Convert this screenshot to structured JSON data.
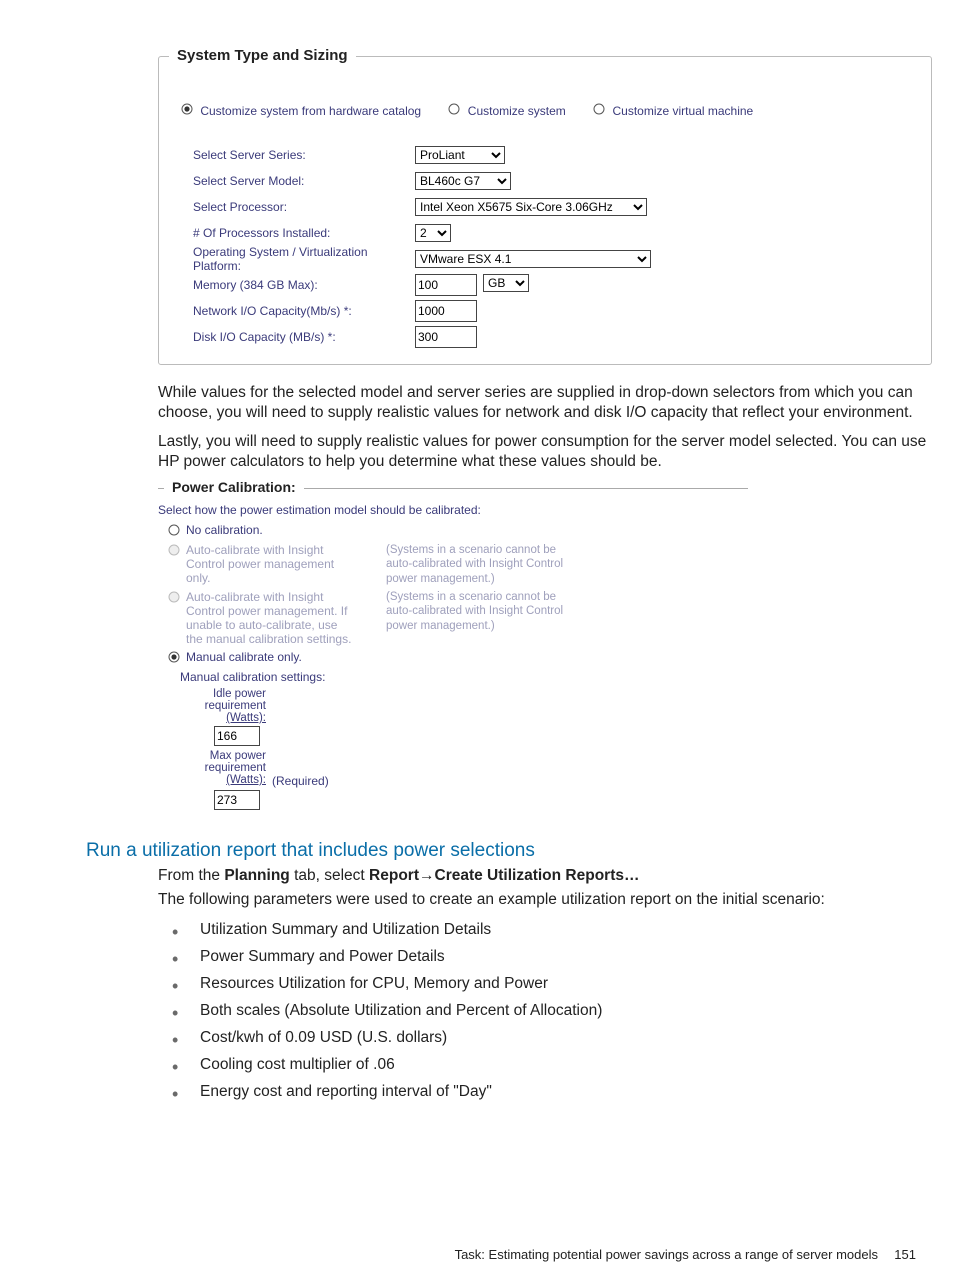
{
  "systemTypeSizing": {
    "legend": "System Type and Sizing",
    "radios": {
      "r1": "Customize system from hardware catalog",
      "r2": "Customize system",
      "r3": "Customize virtual machine"
    },
    "labels": {
      "series": "Select Server Series:",
      "model": "Select Server Model:",
      "processor": "Select Processor:",
      "numproc": "# Of Processors Installed:",
      "os": "Operating System / Virtualization Platform:",
      "memory": "Memory (384 GB Max):",
      "netio": "Network I/O Capacity(Mb/s) *:",
      "diskio": "Disk I/O Capacity (MB/s) *:"
    },
    "values": {
      "series": "ProLiant",
      "model": "BL460c G7",
      "processor": "Intel Xeon X5675 Six-Core 3.06GHz",
      "numproc": "2",
      "os": "VMware ESX 4.1",
      "memory_qty": "100",
      "memory_unit": "GB",
      "netio": "1000",
      "diskio": "300"
    }
  },
  "paras": {
    "p1": "While values for the selected model and server series are supplied in drop-down selectors from which you can choose, you will need to supply realistic values for network and disk I/O capacity that reflect your environment.",
    "p2": "Lastly, you will need to supply realistic values for power consumption for the server model selected. You can use HP power calculators to help you determine what these values should be."
  },
  "powerCal": {
    "legend": "Power Calibration:",
    "prompt": "Select how the power estimation model should be calibrated:",
    "opts": {
      "no": "No calibration.",
      "auto1": "Auto-calibrate with Insight Control power management only.",
      "auto2": "Auto-calibrate with Insight Control power management. If unable to auto-calibrate, use the manual calibration settings.",
      "manual": "Manual calibrate only."
    },
    "hint": "(Systems in a scenario cannot be auto-calibrated with Insight Control power management.)",
    "manualSettings": {
      "title": "Manual calibration settings:",
      "idle_l1": "Idle power",
      "idle_l2": "requirement",
      "watts": "(Watts):",
      "max_l1": "Max power",
      "max_l2": "requirement",
      "idle_val": "166",
      "max_val": "273",
      "required": "(Required)"
    }
  },
  "sectionHeading": "Run a utilization report that includes power selections",
  "instr": {
    "pre": "From the ",
    "b1": "Planning",
    "mid1": " tab, select ",
    "b2": "Report",
    "arrow": "→",
    "b3": "Create Utilization Reports…",
    "p2": "The following parameters were used to create an example utilization report on the initial scenario:"
  },
  "params": [
    "Utilization Summary and Utilization Details",
    "Power Summary and Power Details",
    "Resources Utilization for CPU, Memory and Power",
    "Both scales (Absolute Utilization and Percent of Allocation)",
    "Cost/kwh of 0.09 USD (U.S. dollars)",
    "Cooling cost multiplier of .06",
    "Energy cost and reporting interval of \"Day\""
  ],
  "footer": {
    "task": "Task: Estimating potential power savings across a range of server models",
    "page": "151"
  }
}
